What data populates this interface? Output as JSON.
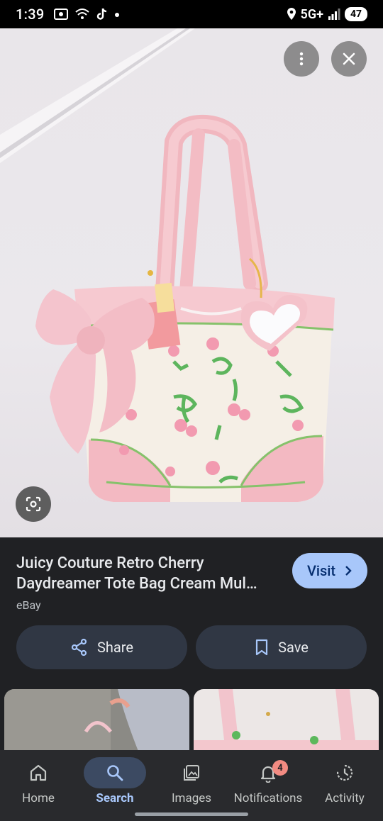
{
  "status_bar": {
    "time": "1:39",
    "network": "5G+",
    "battery": "47"
  },
  "viewer": {
    "more_icon": "more-vert-icon",
    "close_icon": "close-icon",
    "lens_icon": "google-lens-icon"
  },
  "result": {
    "title_line1": "Juicy Couture Retro Cherry",
    "title_line2": "Daydreamer Tote Bag Cream Mul…",
    "source": "eBay",
    "visit_label": "Visit",
    "share_label": "Share",
    "save_label": "Save"
  },
  "nav": {
    "items": [
      {
        "label": "Home",
        "icon": "home-icon"
      },
      {
        "label": "Search",
        "icon": "search-icon"
      },
      {
        "label": "Images",
        "icon": "images-icon"
      },
      {
        "label": "Notifications",
        "icon": "bell-icon",
        "badge": "4"
      },
      {
        "label": "Activity",
        "icon": "activity-icon"
      }
    ]
  },
  "colors": {
    "background": "#202124",
    "accent": "#a8c7fa",
    "button_bg": "#303744",
    "nav_bg": "#292a2d"
  }
}
